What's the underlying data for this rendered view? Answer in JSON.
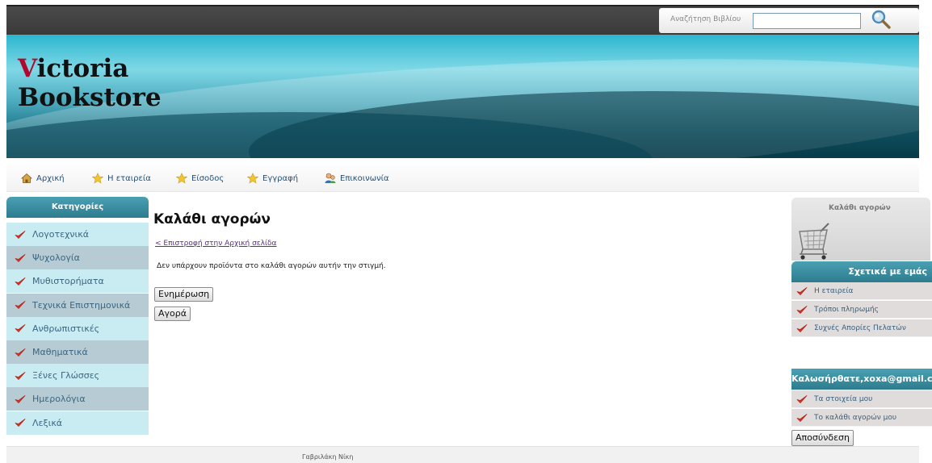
{
  "search": {
    "label": "Αναζήτηση Βιβλίου",
    "value": "",
    "icon": "magnifier-icon"
  },
  "brand": {
    "line1_first": "V",
    "line1_rest": "ictoria",
    "line2": "Bookstore",
    "accent_color": "#b1082b"
  },
  "nav": [
    {
      "label": "Αρχική",
      "icon": "home-icon"
    },
    {
      "label": "Η εταιρεία",
      "icon": "star-icon"
    },
    {
      "label": "Είσοδος",
      "icon": "star-icon"
    },
    {
      "label": "Εγγραφή",
      "icon": "star-icon"
    },
    {
      "label": "Επικοινωνία",
      "icon": "contact-icon"
    }
  ],
  "categories": {
    "title": "Κατηγορίες",
    "items": [
      "Λογοτεχνικά",
      "Ψυχολογία",
      "Μυθιστορήματα",
      "Τεχνικά Επιστημονικά",
      "Ανθρωπιστικές",
      "Μαθηματικά",
      "Ξένες Γλώσσες",
      "Ημερολόγια",
      "Λεξικά"
    ]
  },
  "main": {
    "title": "Καλάθι αγορών",
    "back_link": "< Επιστροφή στην Αρχική σελίδα",
    "empty_message": "Δεν υπάρχουν προϊόντα στο καλάθι αγορών αυτήν την στιγμή.",
    "update_button": "Ενημέρωση",
    "buy_button": "Αγορά"
  },
  "cart_box": {
    "title": "Καλάθι αγορών",
    "icon": "shopping-cart-icon"
  },
  "about": {
    "title": "Σχετικά με εμάς",
    "items": [
      "Η εταιρεία",
      "Τρόποι πληρωμής",
      "Συχνές Απορίες Πελατών"
    ]
  },
  "account": {
    "welcome": "Καλωσήρθατε,xoxa@gmail.com",
    "items": [
      "Τα στοιχεία μου",
      "Το καλάθι αγορών μου"
    ],
    "logout_button": "Αποσύνδεση"
  },
  "footer": {
    "text": "Γαβριλάκη Νίκη"
  },
  "colors": {
    "header_teal": "#2d7c8e",
    "check_red": "#e0362a",
    "link": "#1f4f7a"
  }
}
